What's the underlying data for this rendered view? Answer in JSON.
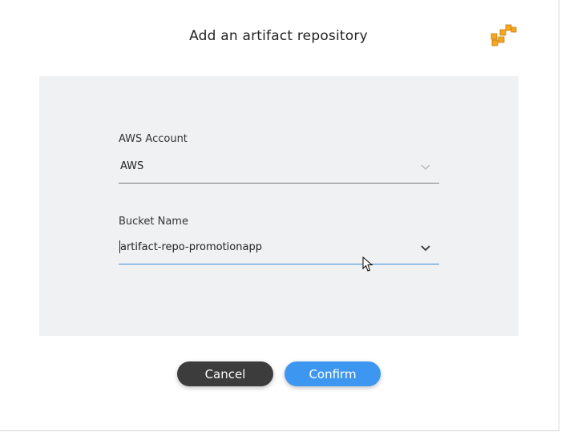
{
  "dialog": {
    "title": "Add an artifact repository",
    "logo_icon": "aws-cubes-icon"
  },
  "form": {
    "account": {
      "label": "AWS Account",
      "value": "AWS",
      "state": "disabled"
    },
    "bucket": {
      "label": "Bucket Name",
      "value": "artifact-repo-promotionapp",
      "state": "focused"
    }
  },
  "actions": {
    "cancel_label": "Cancel",
    "confirm_label": "Confirm"
  },
  "colors": {
    "panel_bg": "#f0f1f2",
    "cancel_bg": "#3c3c3c",
    "confirm_bg": "#3d97f0",
    "focus_underline": "#3a8fd6",
    "logo_orange": "#f5a623"
  }
}
